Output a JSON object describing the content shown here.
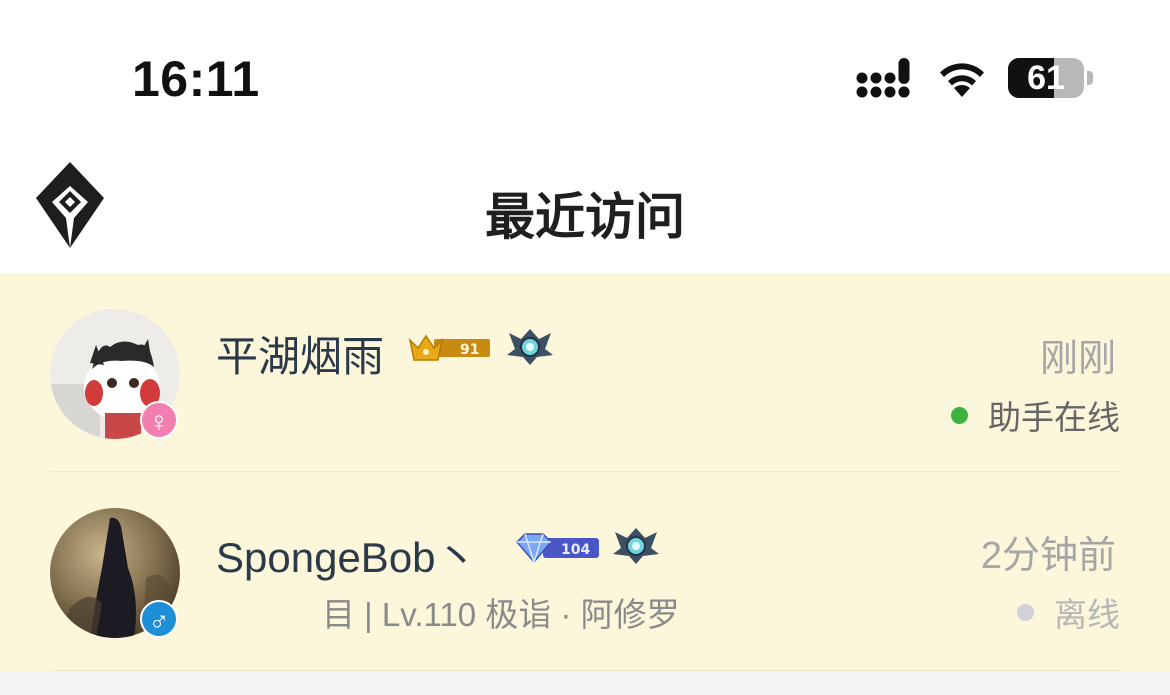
{
  "status_bar": {
    "time": "16:11",
    "battery_level": 61,
    "battery_label": "61",
    "icons": [
      "signal-icon",
      "wifi-icon",
      "battery-icon"
    ]
  },
  "nav": {
    "title": "最近访问",
    "logo_icon": "app-logo-icon"
  },
  "colors": {
    "list_background": "#fcf6da",
    "online_green": "#3cb43c",
    "offline_gray": "#cfd3d9",
    "female_pink": "#f27fb0",
    "male_blue": "#1c8fd6"
  },
  "visitors": [
    {
      "name": "平湖烟雨",
      "gender": "female",
      "gender_symbol": "♀",
      "level_badge": "91",
      "level_badge_icon": "gold-crown-level-badge-icon",
      "rank_icon": "rank-emblem-icon",
      "sub_text": "",
      "time_ago": "刚刚",
      "status": "助手在线",
      "status_color": "green"
    },
    {
      "name": "SpongeBob丶",
      "gender": "male",
      "gender_symbol": "♂",
      "level_badge": "104",
      "level_badge_icon": "diamond-level-badge-icon",
      "rank_icon": "rank-emblem-icon",
      "sub_text": "目 | Lv.110 极诣 · 阿修罗",
      "time_ago": "2分钟前",
      "status": "离线",
      "status_color": "gray"
    }
  ]
}
